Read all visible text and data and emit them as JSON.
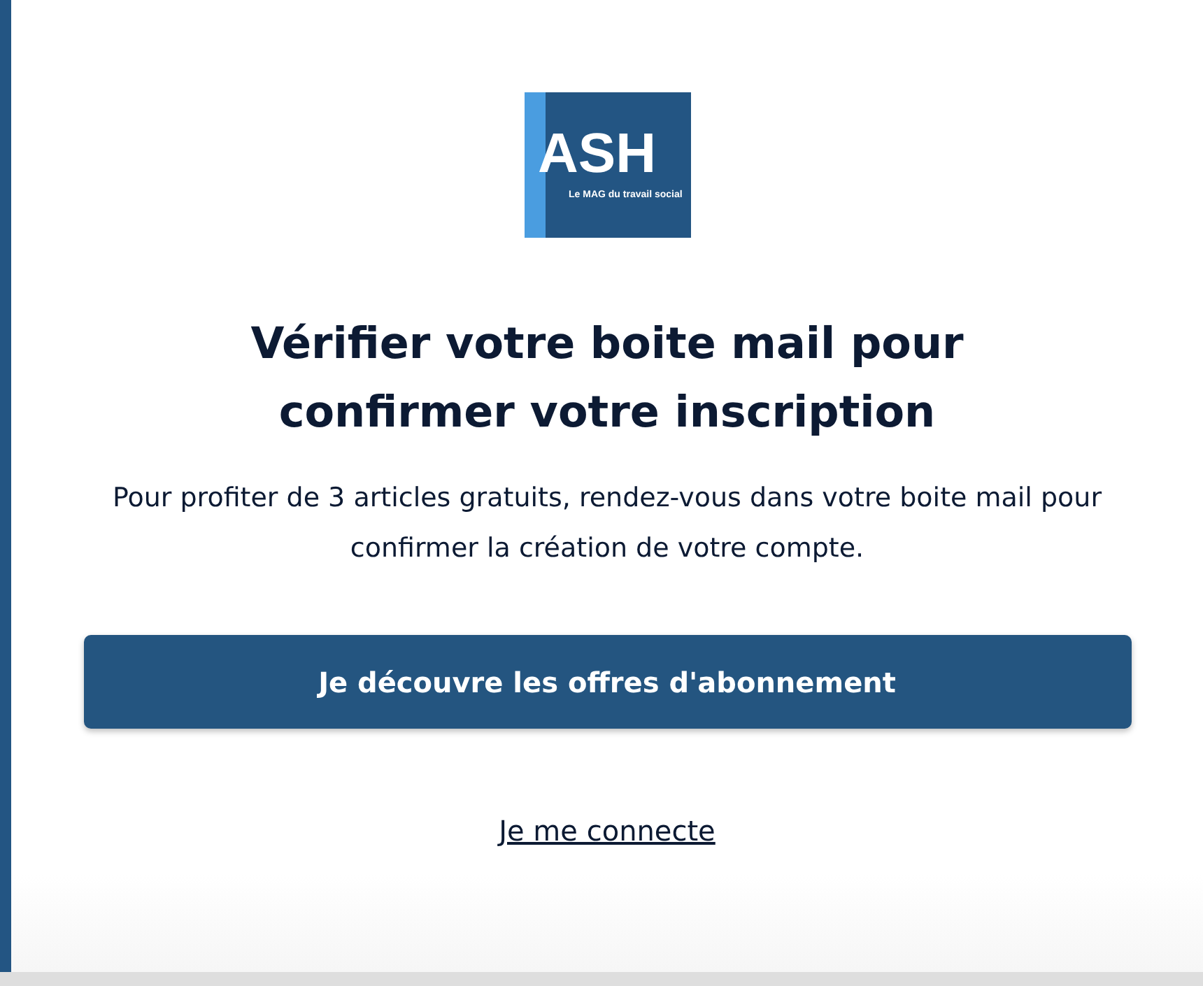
{
  "logo": {
    "title": "ASH",
    "tagline": "Le MAG du travail social"
  },
  "heading": "Vérifier votre boite mail pour confirmer votre inscription",
  "message": "Pour profiter de 3 articles gratuits, rendez-vous dans votre boite mail pour confirmer la création de votre compte.",
  "primary_button": "Je découvre les offres d'abonnement",
  "login_link": "Je me connecte"
}
